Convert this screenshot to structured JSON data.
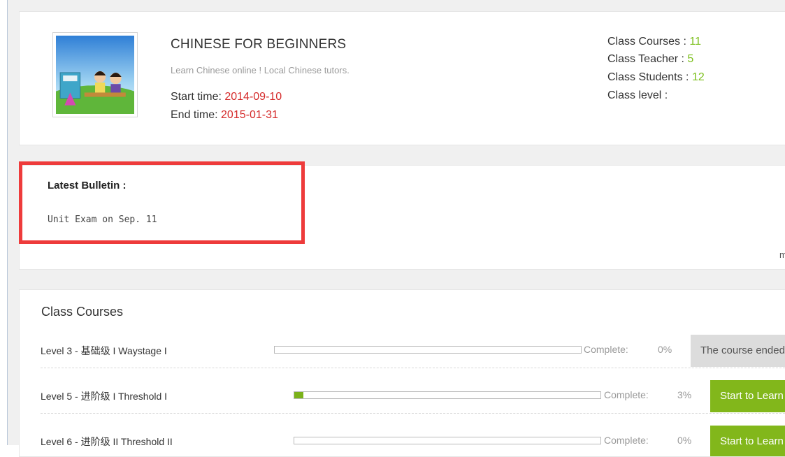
{
  "class_info": {
    "title": "CHINESE FOR BEGINNERS",
    "subtitle": "Learn Chinese online ! Local Chinese tutors.",
    "start_label": "Start time: ",
    "start_date": "2014-09-10",
    "end_label": "End time: ",
    "end_date": "2015-01-31",
    "thumbnail_icon": "class-cover-image",
    "stats": {
      "courses_label": "Class Courses : ",
      "courses_value": "11",
      "teacher_label": "Class Teacher : ",
      "teacher_value": "5",
      "students_label": "Class Students : ",
      "students_value": "12",
      "level_label": "Class level :"
    }
  },
  "bulletin": {
    "title": "Latest Bulletin :",
    "text": "Unit Exam on Sep. 11",
    "more": "m"
  },
  "courses": {
    "title": "Class Courses",
    "complete_label": "Complete:",
    "items": [
      {
        "name": "Level 3 - 基础级 I  Waystage I",
        "percent": "0%",
        "progress": 0,
        "button": "The course ended",
        "status": "ended"
      },
      {
        "name": "Level 5 - 进阶级  I  Threshold  I",
        "percent": "3%",
        "progress": 3,
        "button": "Start to Learn",
        "status": "start"
      },
      {
        "name": "Level 6 - 进阶级  II  Threshold  II",
        "percent": "0%",
        "progress": 0,
        "button": "Start to Learn",
        "status": "start"
      }
    ]
  },
  "colors": {
    "accent_green": "#82b71b",
    "date_red": "#d52b2b",
    "highlight_red": "#ee3b3b"
  }
}
